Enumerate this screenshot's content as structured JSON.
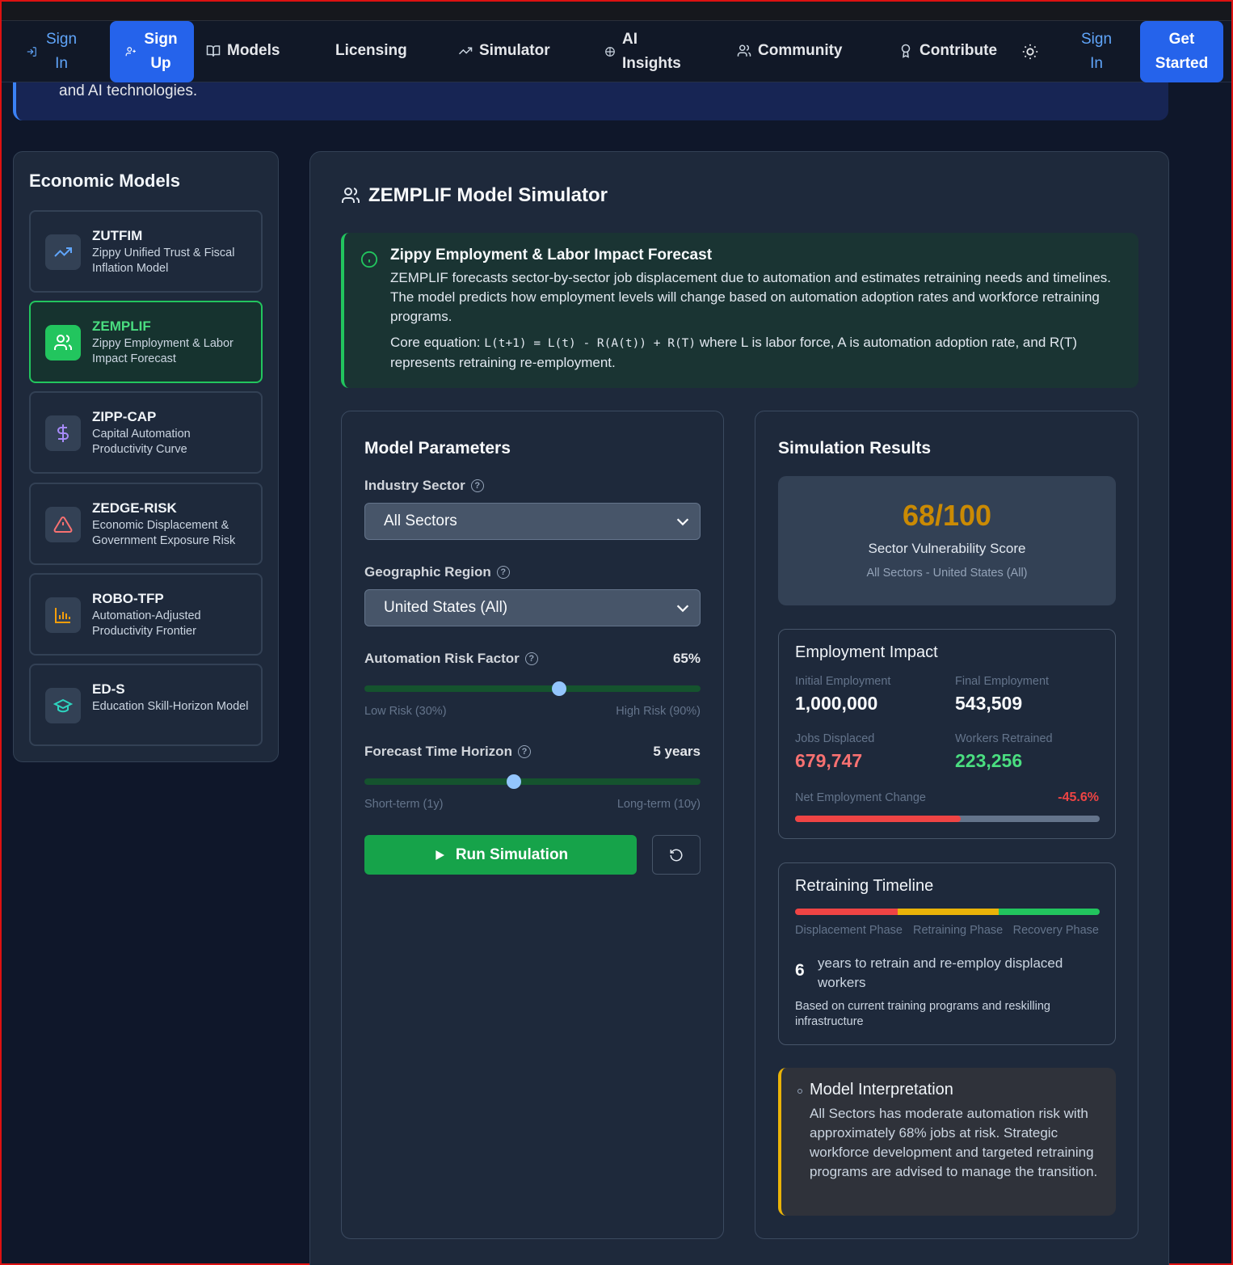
{
  "nav": {
    "sign_in": "Sign In",
    "sign_up": "Sign Up",
    "models": "Models",
    "licensing": "Licensing",
    "simulator": "Simulator",
    "ai_insights": "AI Insights",
    "community": "Community",
    "contribute": "Contribute",
    "sign_in_right": "Sign In",
    "get_started": "Get Started"
  },
  "hero": {
    "tail_text": "and AI technologies."
  },
  "sidebar": {
    "title": "Economic Models",
    "models": [
      {
        "code": "ZUTFIM",
        "desc": "Zippy Unified Trust & Fiscal Inflation Model",
        "icon": "trending-up-icon",
        "color": "#60a5fa"
      },
      {
        "code": "ZEMPLIF",
        "desc": "Zippy Employment & Labor Impact Forecast",
        "icon": "users-icon",
        "color": "#ffffff"
      },
      {
        "code": "ZIPP-CAP",
        "desc": "Capital Automation Productivity Curve",
        "icon": "dollar-icon",
        "color": "#a78bfa"
      },
      {
        "code": "ZEDGE-RISK",
        "desc": "Economic Displacement & Government Exposure Risk",
        "icon": "alert-triangle-icon",
        "color": "#f87171"
      },
      {
        "code": "ROBO-TFP",
        "desc": "Automation-Adjusted Productivity Frontier",
        "icon": "bar-chart-icon",
        "color": "#f59e0b"
      },
      {
        "code": "ED-S",
        "desc": "Education Skill-Horizon Model",
        "icon": "graduation-cap-icon",
        "color": "#2dd4bf"
      }
    ],
    "active_index": 1
  },
  "main": {
    "title": "ZEMPLIF Model Simulator",
    "info": {
      "heading": "Zippy Employment & Labor Impact Forecast",
      "body": "ZEMPLIF forecasts sector-by-sector job displacement due to automation and estimates retraining needs and timelines. The model predicts how employment levels will change based on automation adoption rates and workforce retraining programs.",
      "equation_prefix": "Core equation: ",
      "equation": "L(t+1) = L(t) - R(A(t)) + R(T)",
      "equation_suffix": " where L is labor force, A is automation adoption rate, and R(T) represents retraining re-employment."
    },
    "params": {
      "title": "Model Parameters",
      "industry_label": "Industry Sector",
      "industry_value": "All Sectors",
      "region_label": "Geographic Region",
      "region_value": "United States (All)",
      "risk_label": "Automation Risk Factor",
      "risk_value": "65%",
      "risk_fraction": 0.58,
      "risk_low": "Low Risk (30%)",
      "risk_high": "High Risk (90%)",
      "horizon_label": "Forecast Time Horizon",
      "horizon_value": "5 years",
      "horizon_fraction": 0.445,
      "horizon_low": "Short-term (1y)",
      "horizon_high": "Long-term (10y)",
      "run_label": "Run Simulation"
    },
    "results": {
      "title": "Simulation Results",
      "score": "68/100",
      "score_label": "Sector Vulnerability Score",
      "score_sub": "All Sectors - United States (All)",
      "employment": {
        "title": "Employment Impact",
        "initial_label": "Initial Employment",
        "initial_value": "1,000,000",
        "final_label": "Final Employment",
        "final_value": "543,509",
        "displaced_label": "Jobs Displaced",
        "displaced_value": "679,747",
        "retrained_label": "Workers Retrained",
        "retrained_value": "223,256",
        "net_label": "Net Employment Change",
        "net_value": "-45.6%",
        "net_fraction": 0.545
      },
      "timeline": {
        "title": "Retraining Timeline",
        "phase1": "Displacement Phase",
        "phase2": "Retraining Phase",
        "phase3": "Recovery Phase",
        "years": "6",
        "years_text": "years to retrain and re-employ displaced workers",
        "note": "Based on current training programs and reskilling infrastructure"
      },
      "interpretation": {
        "title": "Model Interpretation",
        "text": "All Sectors has moderate automation risk with approximately 68% jobs at risk. Strategic workforce development and targeted retraining programs are advised to manage the transition."
      }
    }
  }
}
